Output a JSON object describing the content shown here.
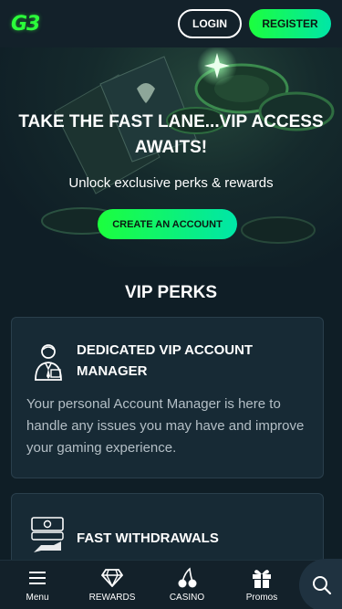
{
  "header": {
    "logo_text": "G3",
    "login_label": "LOGIN",
    "register_label": "REGISTER"
  },
  "hero": {
    "title": "TAKE THE FAST LANE...VIP ACCESS AWAITS!",
    "subtitle": "Unlock exclusive perks & rewards",
    "cta_label": "CREATE AN ACCOUNT"
  },
  "perks": {
    "title": "VIP PERKS",
    "items": [
      {
        "icon": "account-manager-icon",
        "title": "DEDICATED VIP ACCOUNT MANAGER",
        "text": "Your personal Account Manager is here to handle any issues you may have and improve your gaming experience."
      },
      {
        "icon": "cash-hand-icon",
        "title": "FAST WITHDRAWALS",
        "text": ""
      }
    ]
  },
  "bottom_nav": {
    "items": [
      {
        "label": "Menu",
        "icon": "hamburger-icon"
      },
      {
        "label": "REWARDS",
        "icon": "diamond-icon"
      },
      {
        "label": "CASINO",
        "icon": "cherries-icon"
      },
      {
        "label": "Promos",
        "icon": "gift-icon"
      }
    ],
    "search_icon": "search-icon"
  },
  "colors": {
    "accent_green": "#1cff3d",
    "accent_teal": "#00e6a8",
    "background": "#0f1e26",
    "card": "#172a35"
  }
}
